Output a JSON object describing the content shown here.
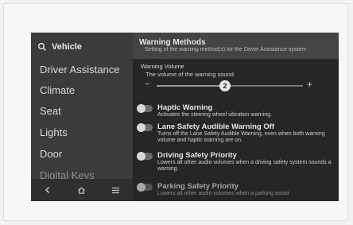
{
  "sidebar": {
    "header": "Vehicle",
    "items": [
      "Driver Assistance",
      "Climate",
      "Seat",
      "Lights",
      "Door",
      "Digital Keys"
    ]
  },
  "main": {
    "title": "Warning Methods",
    "subtitle": "Setting of the warning method(s) for the Driver Assistance system"
  },
  "volume": {
    "label": "Warning Volume",
    "desc": "The volume of the warning sound",
    "value": "2",
    "minus": "−",
    "plus": "+"
  },
  "options": [
    {
      "title": "Haptic Warning",
      "desc": "Activates the steering wheel vibration warning."
    },
    {
      "title": "Lane Safety Audible Warning Off",
      "desc": "Turns off the Lane Safety Audible Warning, even when both warning volume and haptic warning are on."
    },
    {
      "title": "Driving Safety Priority",
      "desc": "Lowers all other audio volumes when a driving safety system sounds a warning."
    },
    {
      "title": "Parking Safety Priority",
      "desc": "Lowers all other audio volumes when a parking assist"
    }
  ],
  "icons": {
    "search": "search-icon",
    "back": "back-icon",
    "home": "home-icon",
    "menu": "menu-icon"
  }
}
